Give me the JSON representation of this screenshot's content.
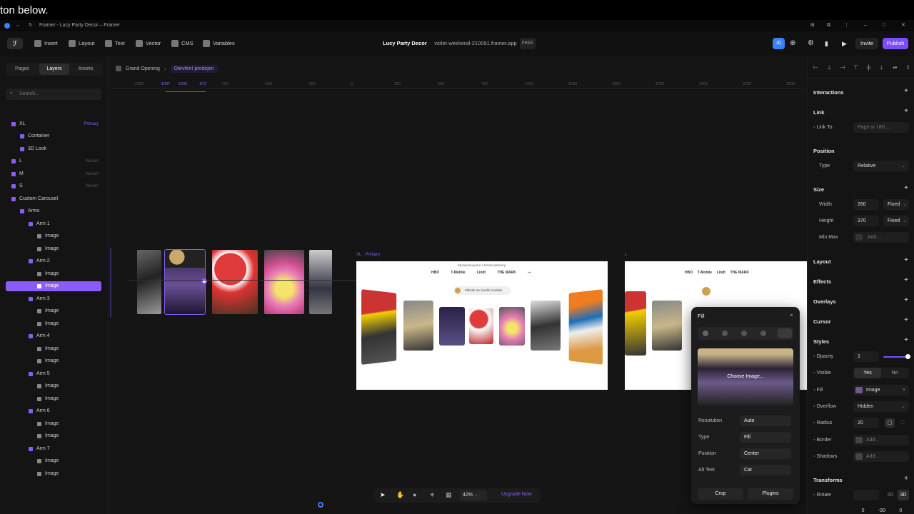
{
  "caption": "ton below.",
  "window": {
    "title": "Framer - Lucy Party Decor – Framer"
  },
  "toolbar": {
    "insert": "Insert",
    "layout": "Layout",
    "text": "Text",
    "vector": "Vector",
    "cms": "CMS",
    "variables": "Variables",
    "project": "Lucy Party Decor",
    "url": "violet-weekend-210091.framer.app",
    "plan": "FREE",
    "avatar": "JD",
    "invite": "Invite",
    "publish": "Publish"
  },
  "leftpanel": {
    "tabs": [
      "Pages",
      "Layers",
      "Assets"
    ],
    "search_placeholder": "Search...",
    "layers": [
      {
        "label": "XL",
        "tag": "Primary"
      },
      {
        "label": "Container",
        "tag": ""
      },
      {
        "label": "3D Look",
        "tag": ""
      },
      {
        "label": "L",
        "tag": "Variant"
      },
      {
        "label": "M",
        "tag": "Variant"
      },
      {
        "label": "S",
        "tag": "Variant"
      },
      {
        "label": "Custom Carousel",
        "tag": ""
      },
      {
        "label": "Arms",
        "tag": ""
      },
      {
        "label": "Arm 1",
        "tag": ""
      },
      {
        "label": "Image",
        "tag": ""
      },
      {
        "label": "Image",
        "tag": ""
      },
      {
        "label": "Arm 2",
        "tag": ""
      },
      {
        "label": "Image",
        "tag": ""
      },
      {
        "label": "Image",
        "tag": ""
      },
      {
        "label": "Arm 3",
        "tag": ""
      },
      {
        "label": "Image",
        "tag": ""
      },
      {
        "label": "Image",
        "tag": ""
      },
      {
        "label": "Arm 4",
        "tag": ""
      },
      {
        "label": "Image",
        "tag": ""
      },
      {
        "label": "Image",
        "tag": ""
      },
      {
        "label": "Arm 5",
        "tag": ""
      },
      {
        "label": "Image",
        "tag": ""
      },
      {
        "label": "Image",
        "tag": ""
      },
      {
        "label": "Arm 6",
        "tag": ""
      },
      {
        "label": "Image",
        "tag": ""
      },
      {
        "label": "Image",
        "tag": ""
      },
      {
        "label": "Arm 7",
        "tag": ""
      },
      {
        "label": "Image",
        "tag": ""
      },
      {
        "label": "Image",
        "tag": ""
      }
    ]
  },
  "canvas": {
    "breadcrumb": [
      "Grand Opening",
      "Otevření prodejen"
    ],
    "ruler_labels": [
      "-1250",
      "-1097",
      "-1000",
      "-872",
      "-750",
      "-500",
      "-250",
      "0",
      "250",
      "500",
      "750",
      "1000",
      "1250",
      "1500",
      "1750",
      "2000",
      "2250",
      "2500"
    ],
    "frame_xl_label": "XL · Primary",
    "frame_l_label": "L",
    "partner_text": "Spolupracujeme s těmito partnery:",
    "cta_text": "Kliknite na úvodní novinku",
    "logos": [
      "HBO",
      "T-Mobile",
      "Lindt",
      "THE MARK",
      "⋯"
    ],
    "zoom": "42%",
    "upgrade": "Upgrade Now"
  },
  "fill_popup": {
    "title": "Fill",
    "choose": "Choose Image...",
    "rows": [
      {
        "label": "Resolution",
        "value": "Auto"
      },
      {
        "label": "Type",
        "value": "Fill"
      },
      {
        "label": "Position",
        "value": "Center"
      },
      {
        "label": "Alt Text",
        "value": "Car"
      }
    ],
    "crop": "Crop",
    "plugins": "Plugins"
  },
  "rightpanel": {
    "interactions": "Interactions",
    "link": "Link",
    "link_to": "Link To",
    "link_placeholder": "Page or URL...",
    "position": "Position",
    "type_label": "Type",
    "type_value": "Relative",
    "size": "Size",
    "width_label": "Width",
    "width": "260",
    "width_mode": "Fixed",
    "height_label": "Height",
    "height": "370",
    "height_mode": "Fixed",
    "minmax_label": "Min Max",
    "add": "Add...",
    "layout": "Layout",
    "effects": "Effects",
    "overlays": "Overlays",
    "cursor": "Cursor",
    "styles": "Styles",
    "opacity_label": "Opacity",
    "opacity": "1",
    "visible_label": "Visible",
    "yes": "Yes",
    "no": "No",
    "fill_label": "Fill",
    "fill_value": "Image",
    "overflow_label": "Overflow",
    "overflow": "Hidden",
    "radius_label": "Radius",
    "radius": "20",
    "border_label": "Border",
    "shadows_label": "Shadows",
    "transforms": "Transforms",
    "rotate_label": "Rotate",
    "mode_2d": "2D",
    "mode_3d": "3D",
    "rot_values": [
      "0",
      "-90",
      "0"
    ]
  },
  "colors": {
    "accent": "#8b5cf6",
    "publish": "#7c4dff",
    "avatar": "#3b82f6"
  }
}
